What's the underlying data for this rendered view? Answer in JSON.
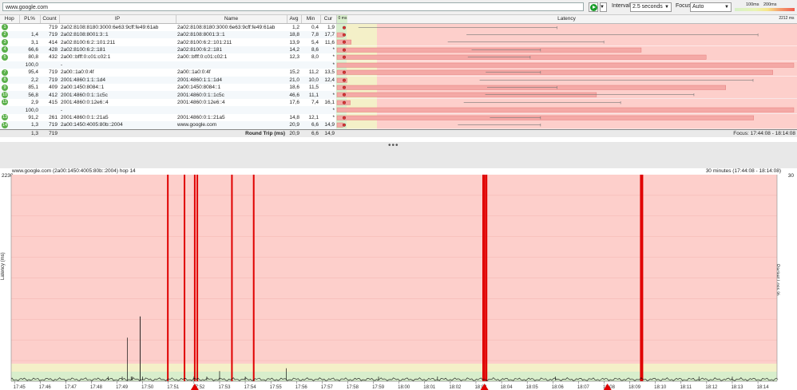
{
  "toolbar": {
    "target": "www.google.com",
    "interval_label": "Interval",
    "interval_value": "2.5 seconds",
    "focus_label": "Focus",
    "focus_value": "Auto",
    "scale_100": "100ms",
    "scale_200": "200ms"
  },
  "columns": {
    "hop": "Hop",
    "pl": "PL%",
    "count": "Count",
    "ip": "IP",
    "name": "Name",
    "avg": "Avg",
    "min": "Min",
    "cur": "Cur",
    "graph_left": "0 ms",
    "graph_title": "Latency",
    "graph_right": "2212 ms"
  },
  "hops": [
    {
      "hop": "1",
      "pl": "",
      "count": "719",
      "ip": "2a02:8108:8180:3000:6e63:9cff:fe49:61ab",
      "name": "2a02:8108:8180:3000:6e63:9cff:fe49:61ab",
      "avg": "1,2",
      "min": "0,4",
      "cur": "1,9",
      "avg_ms": 1.2,
      "min_ms": 0.4,
      "max_ms": 40,
      "cur_ms": 1.9,
      "loss": 0
    },
    {
      "hop": "2",
      "pl": "1,4",
      "count": "719",
      "ip": "2a02:8108:8001:3::1",
      "name": "2a02:8108:8001:3::1",
      "avg": "18,8",
      "min": "7,8",
      "cur": "17,7",
      "avg_ms": 18.8,
      "min_ms": 7.8,
      "max_ms": 1250,
      "cur_ms": 17.7,
      "loss": 1.4
    },
    {
      "hop": "3",
      "pl": "3,1",
      "count": "414",
      "ip": "2a02:8100:6:2::101:211",
      "name": "2a02:8100:6:2::101:211",
      "avg": "13,9",
      "min": "5,4",
      "cur": "11,6",
      "avg_ms": 13.9,
      "min_ms": 5.4,
      "max_ms": 90,
      "cur_ms": 11.6,
      "loss": 3.1
    },
    {
      "hop": "4",
      "pl": "66,6",
      "count": "428",
      "ip": "2a02:8100:6:2::181",
      "name": "2a02:8100:6:2::181",
      "avg": "14,2",
      "min": "8,6",
      "cur": "*",
      "avg_ms": 14.2,
      "min_ms": 8.6,
      "max_ms": 30,
      "cur_ms": null,
      "loss": 66.6
    },
    {
      "hop": "5",
      "pl": "80,8",
      "count": "432",
      "ip": "2a00::bfff:0:c01:c02:1",
      "name": "2a00::bfff:0:c01:c02:1",
      "avg": "12,3",
      "min": "8,0",
      "cur": "*",
      "avg_ms": 12.3,
      "min_ms": 8.0,
      "max_ms": 25,
      "cur_ms": null,
      "loss": 80.8
    },
    {
      "hop": "",
      "pl": "100,0",
      "count": "",
      "ip": "-",
      "name": "",
      "avg": "",
      "min": "",
      "cur": "*",
      "avg_ms": null,
      "min_ms": null,
      "max_ms": null,
      "cur_ms": null,
      "loss": 100
    },
    {
      "hop": "7",
      "pl": "95,4",
      "count": "719",
      "ip": "2a00::1a0:0:4f",
      "name": "2a00::1a0:0:4f",
      "avg": "15,2",
      "min": "11,2",
      "cur": "13,5",
      "avg_ms": 15.2,
      "min_ms": 11.2,
      "max_ms": 30,
      "cur_ms": 13.5,
      "loss": 95.4
    },
    {
      "hop": "8",
      "pl": "2,2",
      "count": "719",
      "ip": "2001:4860:1:1::1d4",
      "name": "2001:4860:1:1::1d4",
      "avg": "21,0",
      "min": "10,0",
      "cur": "12,4",
      "avg_ms": 21.0,
      "min_ms": 10.0,
      "max_ms": 1150,
      "cur_ms": 12.4,
      "loss": 2.2
    },
    {
      "hop": "9",
      "pl": "85,1",
      "count": "409",
      "ip": "2a00:1450:8084::1",
      "name": "2a00:1450:8084::1",
      "avg": "18,6",
      "min": "11,5",
      "cur": "*",
      "avg_ms": 18.6,
      "min_ms": 11.5,
      "max_ms": 40,
      "cur_ms": null,
      "loss": 85.1
    },
    {
      "hop": "10",
      "pl": "56,8",
      "count": "412",
      "ip": "2001:4860:0:1::1c5c",
      "name": "2001:4860:0:1::1c5c",
      "avg": "46,6",
      "min": "11,1",
      "cur": "*",
      "avg_ms": 46.6,
      "min_ms": 11.1,
      "max_ms": 420,
      "cur_ms": null,
      "loss": 56.8
    },
    {
      "hop": "11",
      "pl": "2,9",
      "count": "415",
      "ip": "2001:4860:0:12e6::4",
      "name": "2001:4860:0:12e6::4",
      "avg": "17,6",
      "min": "7,4",
      "cur": "16,1",
      "avg_ms": 17.6,
      "min_ms": 7.4,
      "max_ms": 120,
      "cur_ms": 16.1,
      "loss": 2.9
    },
    {
      "hop": "",
      "pl": "100,0",
      "count": "",
      "ip": "-",
      "name": "",
      "avg": "",
      "min": "",
      "cur": "*",
      "avg_ms": null,
      "min_ms": null,
      "max_ms": null,
      "cur_ms": null,
      "loss": 100
    },
    {
      "hop": "13",
      "pl": "91,2",
      "count": "261",
      "ip": "2001:4860:0:1::21a5",
      "name": "2001:4860:0:1::21a5",
      "avg": "14,8",
      "min": "12,1",
      "cur": "*",
      "avg_ms": 14.8,
      "min_ms": 12.1,
      "max_ms": 30,
      "cur_ms": null,
      "loss": 91.2
    },
    {
      "hop": "14",
      "pl": "1,3",
      "count": "719",
      "ip": "2a00:1450:4005:80b::2004",
      "name": "www.google.com",
      "avg": "20,9",
      "min": "6,6",
      "cur": "14,9",
      "avg_ms": 20.9,
      "min_ms": 6.6,
      "max_ms": 30,
      "cur_ms": 14.9,
      "loss": 1.3
    }
  ],
  "summary": {
    "pl": "1,3",
    "count": "719",
    "label": "Round Trip (ms)",
    "avg": "20,9",
    "min": "6,6",
    "cur": "14,9",
    "focus": "Focus: 17:44:08 - 18:14:08"
  },
  "timeline": {
    "title": "www.google.com (2a00:1450:4005:80b::2004) hop 14",
    "range": "30 minutes (17:44:08 - 18:14:08)",
    "y_max_left": "2230",
    "y_max_right": "30",
    "y_title": "Latency (ms)",
    "y2_title": "Packet Loss %",
    "x_ticks": [
      "17:45",
      "17:46",
      "17:47",
      "17:48",
      "17:49",
      "17:50",
      "17:51",
      "17:52",
      "17:53",
      "17:54",
      "17:55",
      "17:56",
      "17:57",
      "17:58",
      "17:59",
      "18:00",
      "18:01",
      "18:02",
      "18:03",
      "18:04",
      "18:05",
      "18:06",
      "18:07",
      "18:08",
      "18:09",
      "18:10",
      "18:11",
      "18:12",
      "18:13",
      "18:14"
    ],
    "loss_markers_min": [
      6.95,
      7.6,
      8.0,
      8.1,
      9.45,
      10.3,
      19.25,
      19.35,
      25.4
    ],
    "loss_markers_width": [
      2,
      2,
      2,
      2,
      2,
      2,
      3,
      3,
      4
    ],
    "arrow_markers_min": [
      8.0,
      19.3,
      24.1
    ],
    "spikes": [
      [
        4.65,
        1
      ],
      [
        5.2,
        1
      ],
      [
        5.4,
        15
      ],
      [
        5.55,
        1
      ],
      [
        5.6,
        1
      ],
      [
        6.0,
        1
      ],
      [
        8.0,
        1
      ],
      [
        8.5,
        1
      ],
      [
        9.0,
        3
      ],
      [
        10.0,
        1
      ],
      [
        11.6,
        4
      ],
      [
        15.2,
        1
      ],
      [
        17.5,
        1
      ],
      [
        22.1,
        1
      ],
      [
        27.7,
        1
      ],
      [
        29.0,
        1
      ]
    ],
    "peak_spike": [
      5.9,
      700
    ],
    "colors": {
      "green": "#d8eecc",
      "yellow": "#f4f0c8",
      "red": "#fdcfcb",
      "loss": "#e00000",
      "line": "#111111"
    }
  }
}
